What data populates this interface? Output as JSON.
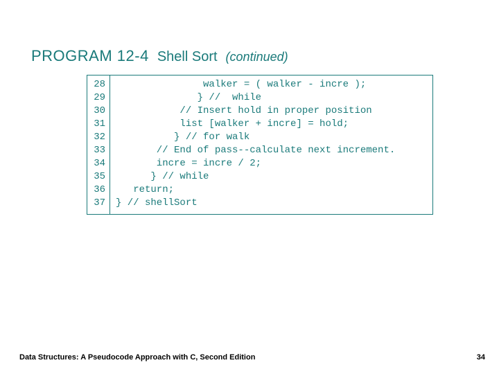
{
  "heading": {
    "program": "PROGRAM 12-4",
    "name": "Shell Sort",
    "continued": "(continued)"
  },
  "code": {
    "lines": [
      {
        "n": "28",
        "text": "               walker = ( walker - incre );"
      },
      {
        "n": "29",
        "text": "              } //  while"
      },
      {
        "n": "30",
        "text": "           // Insert hold in proper position"
      },
      {
        "n": "31",
        "text": "           list [walker + incre] = hold;"
      },
      {
        "n": "32",
        "text": "          } // for walk"
      },
      {
        "n": "33",
        "text": "       // End of pass--calculate next increment."
      },
      {
        "n": "34",
        "text": "       incre = incre / 2;"
      },
      {
        "n": "35",
        "text": "      } // while"
      },
      {
        "n": "36",
        "text": "   return;"
      },
      {
        "n": "37",
        "text": "} // shellSort"
      }
    ]
  },
  "footer": {
    "left": "Data Structures: A Pseudocode Approach with C, Second Edition",
    "right": "34"
  }
}
